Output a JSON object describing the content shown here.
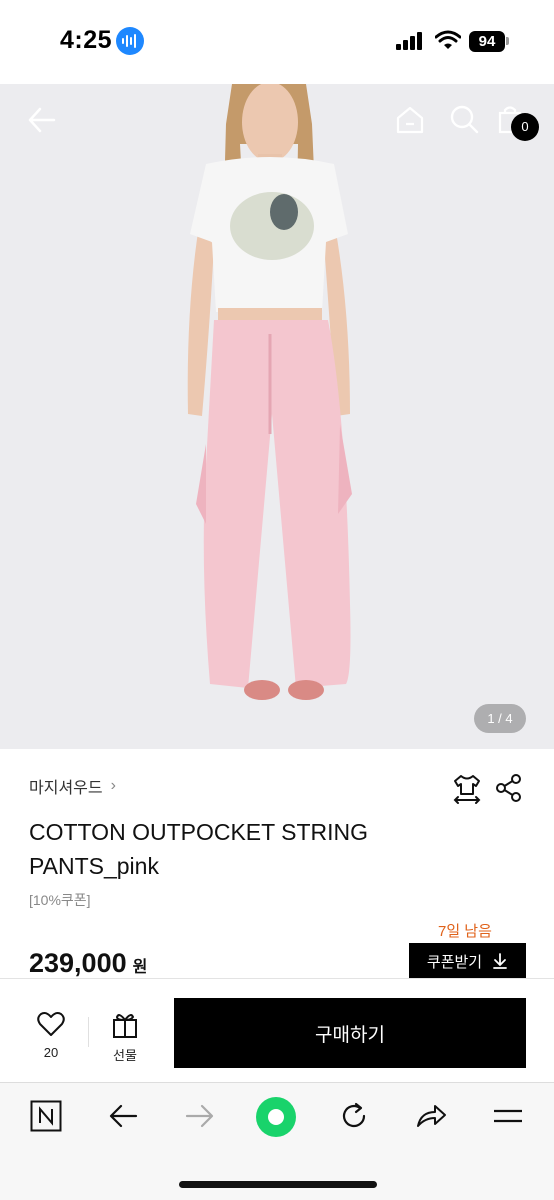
{
  "status_bar": {
    "time": "4:25",
    "battery": "94"
  },
  "hero": {
    "pager": "1 / 4",
    "cart_count": "0",
    "colors": {
      "background": "#ececef",
      "tshirt": "#f6f6f6",
      "pants": "#f4c6cf",
      "hair": "#c49a6a",
      "skin": "#ecc8b0",
      "shoes": "#d98a85"
    }
  },
  "product": {
    "brand": "마지셔우드",
    "title_line1": "COTTON OUTPOCKET STRING",
    "title_line2": "PANTS_pink",
    "coupon_note": "[10%쿠폰]",
    "days_left": "7일 남음",
    "price": "239,000",
    "price_unit": "원",
    "coupon_button": "쿠폰받기",
    "accent_color": "#e0621a"
  },
  "action_bar": {
    "like_count": "20",
    "gift_label": "선물",
    "buy_label": "구매하기"
  },
  "icons": {
    "status": [
      "voice-memo-icon",
      "signal-icon",
      "wifi-icon",
      "battery-icon"
    ],
    "hero": [
      "back-arrow-icon",
      "home-icon",
      "search-icon",
      "shopping-bag-icon"
    ],
    "product": [
      "tshirt-size-icon",
      "share-icon"
    ],
    "action": [
      "heart-icon",
      "gift-icon"
    ],
    "browser": [
      "naver-n-icon",
      "back-icon",
      "forward-icon",
      "green-circle-icon",
      "refresh-icon",
      "share-arrow-icon",
      "menu-icon"
    ]
  }
}
